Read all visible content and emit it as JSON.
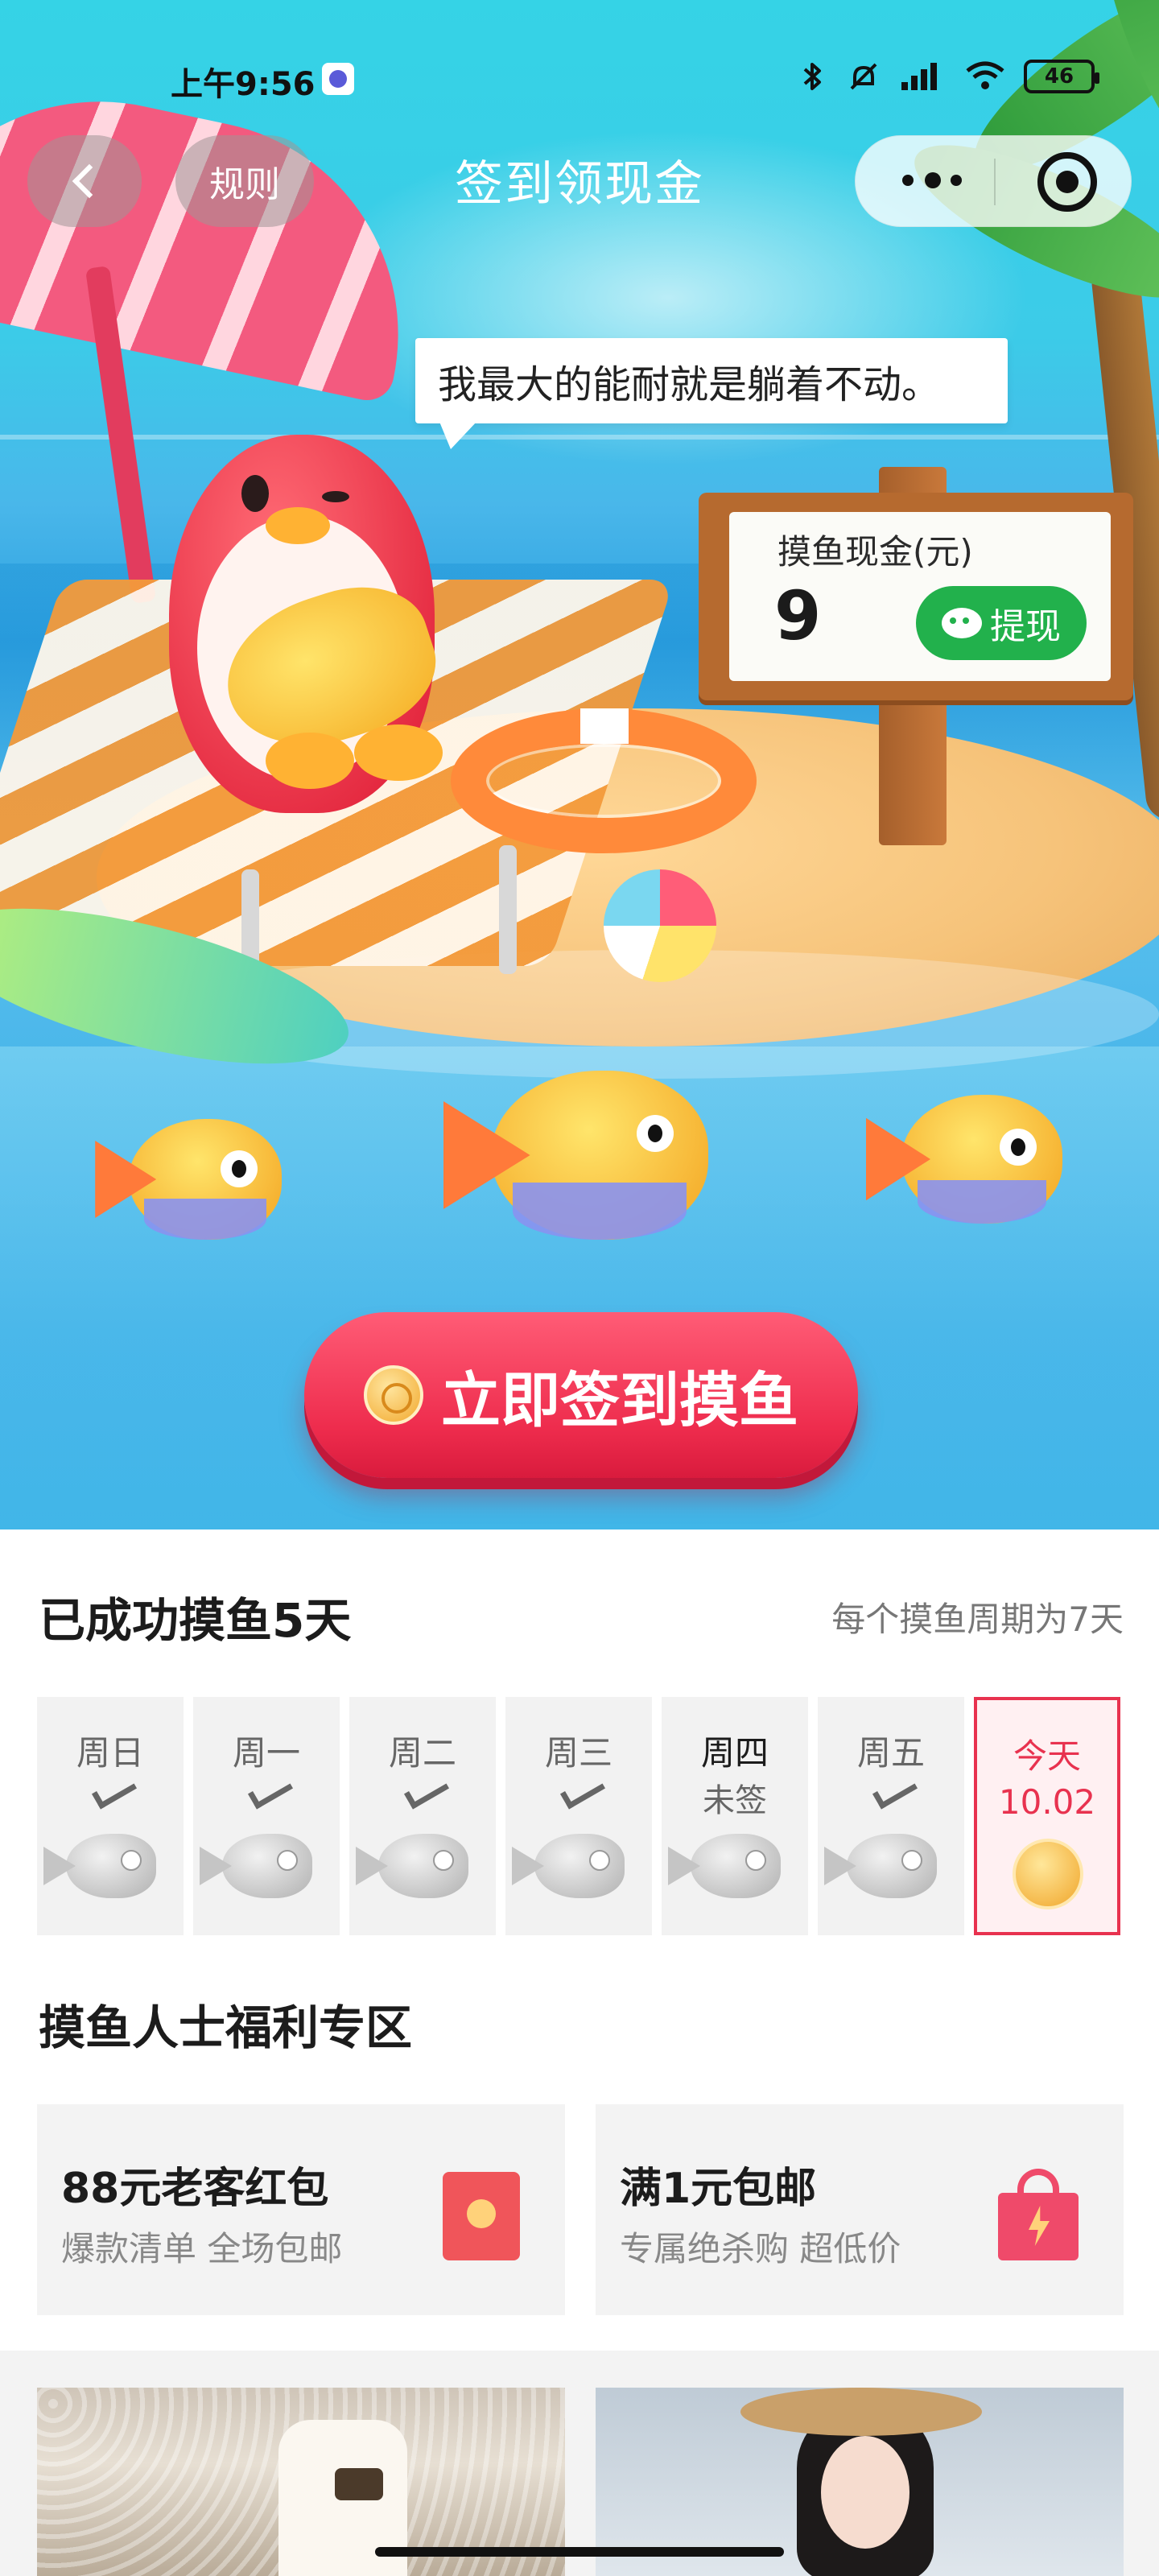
{
  "status_bar": {
    "time": "上午9:56",
    "battery": "46",
    "icons": [
      "bluetooth-icon",
      "mute-icon",
      "signal-icon",
      "wifi-icon",
      "battery-icon"
    ]
  },
  "nav": {
    "rules_label": "规则",
    "title": "签到领现金",
    "capsule_icons": [
      "more-icon",
      "close-mini-program-icon"
    ]
  },
  "hero": {
    "speech": "我最大的能耐就是躺着不动。",
    "cash_label": "摸鱼现金(元)",
    "cash_value": "9",
    "withdraw_label": "提现",
    "signin_label": "立即签到摸鱼"
  },
  "checkin": {
    "title": "已成功摸鱼5天",
    "cycle_note": "每个摸鱼周期为7天",
    "days": [
      {
        "name": "周日",
        "status": "checked"
      },
      {
        "name": "周一",
        "status": "checked"
      },
      {
        "name": "周二",
        "status": "checked"
      },
      {
        "name": "周三",
        "status": "checked"
      },
      {
        "name": "周四",
        "status": "missed",
        "label": "未签"
      },
      {
        "name": "周五",
        "status": "checked"
      },
      {
        "name": "今天",
        "status": "today",
        "date": "10.02"
      }
    ]
  },
  "welfare": {
    "title": "摸鱼人士福利专区",
    "cards": [
      {
        "title": "88元老客红包",
        "subtitle": "爆款清单 全场包邮",
        "icon": "red-packet-icon"
      },
      {
        "title": "满1元包邮",
        "subtitle": "专属绝杀购 超低价",
        "icon": "shopping-bag-icon"
      }
    ]
  },
  "colors": {
    "accent_red": "#e8324f",
    "withdraw_green": "#22b14c",
    "sky": "#35d3e6"
  }
}
